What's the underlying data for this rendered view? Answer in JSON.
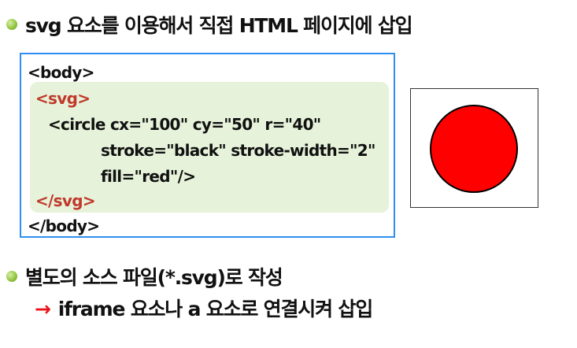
{
  "bullet_1": "svg 요소를 이용해서 직접 HTML 페이지에 삽입",
  "code": {
    "body_open": "<body>",
    "svg_open": "<svg>",
    "circle_line_1": "<circle cx=\"100\" cy=\"50\" r=\"40\"",
    "circle_line_2": "stroke=\"black\" stroke-width=\"2\"",
    "circle_line_3": "fill=\"red\"/>",
    "svg_close": "</svg>",
    "body_close": "</body>"
  },
  "preview": {
    "fill_color": "#ff0000",
    "stroke_color": "#000000"
  },
  "bullet_2": "별도의 소스 파일(*.svg)로 작성",
  "bullet_2_sub": {
    "arrow": "→",
    "text": "iframe 요소나 a 요소로 연결시켜 삽입"
  },
  "colors": {
    "bullet_green": "#8fc33c",
    "code_border": "#2f8ff0",
    "code_highlight_bg": "#e6f3da",
    "svg_tag": "#c0392b",
    "arrow": "#e8141b"
  }
}
